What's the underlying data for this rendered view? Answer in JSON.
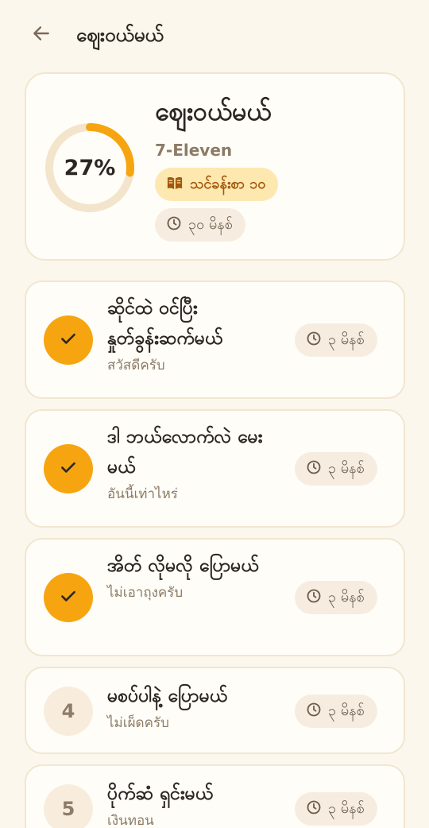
{
  "header": {
    "title": "ဈေးဝယ်မယ်"
  },
  "hero": {
    "title": "ဈေးဝယ်မယ်",
    "subtitle": "7-Eleven",
    "progress_percent": 27,
    "progress_label": "27%",
    "lesson_label": "သင်ခန်းစာ ၁၀",
    "duration_label": "၃၀ မိနစ်"
  },
  "steps": [
    {
      "badge": "check-icon",
      "done": true,
      "title": "ဆိုင်ထဲ ဝင်ပြီး နှုတ်ခွန်းဆက်မယ်",
      "subtitle": "สวัสดีครับ",
      "duration": "၃ မိနစ်"
    },
    {
      "badge": "check-icon",
      "done": true,
      "title": "ဒါ ဘယ်လောက်လဲ မေးမယ်",
      "subtitle": "อันนี้เท่าไหร่",
      "duration": "၃ မိနစ်"
    },
    {
      "badge": "check-icon",
      "done": true,
      "title": "အိတ် လိုမလို ပြောမယ်",
      "subtitle": "ไม่เอาถุงครับ",
      "duration": "၃ မိနစ်"
    },
    {
      "badge": "4",
      "done": false,
      "title": "မစပ်ပါနဲ့ ပြောမယ်",
      "subtitle": "ไม่เผ็ดครับ",
      "duration": "၃ မိနစ်"
    },
    {
      "badge": "5",
      "done": false,
      "title": "ပိုက်ဆံ ရှင်းမယ်",
      "subtitle": "เงินทอน",
      "duration": "၃ မိနစ်"
    }
  ],
  "colors": {
    "accent": "#f6a511",
    "background": "#fcf7ec",
    "card": "#fffdf8",
    "lesson_chip": "#fde8b0",
    "lesson_chip_text": "#a2570c"
  }
}
